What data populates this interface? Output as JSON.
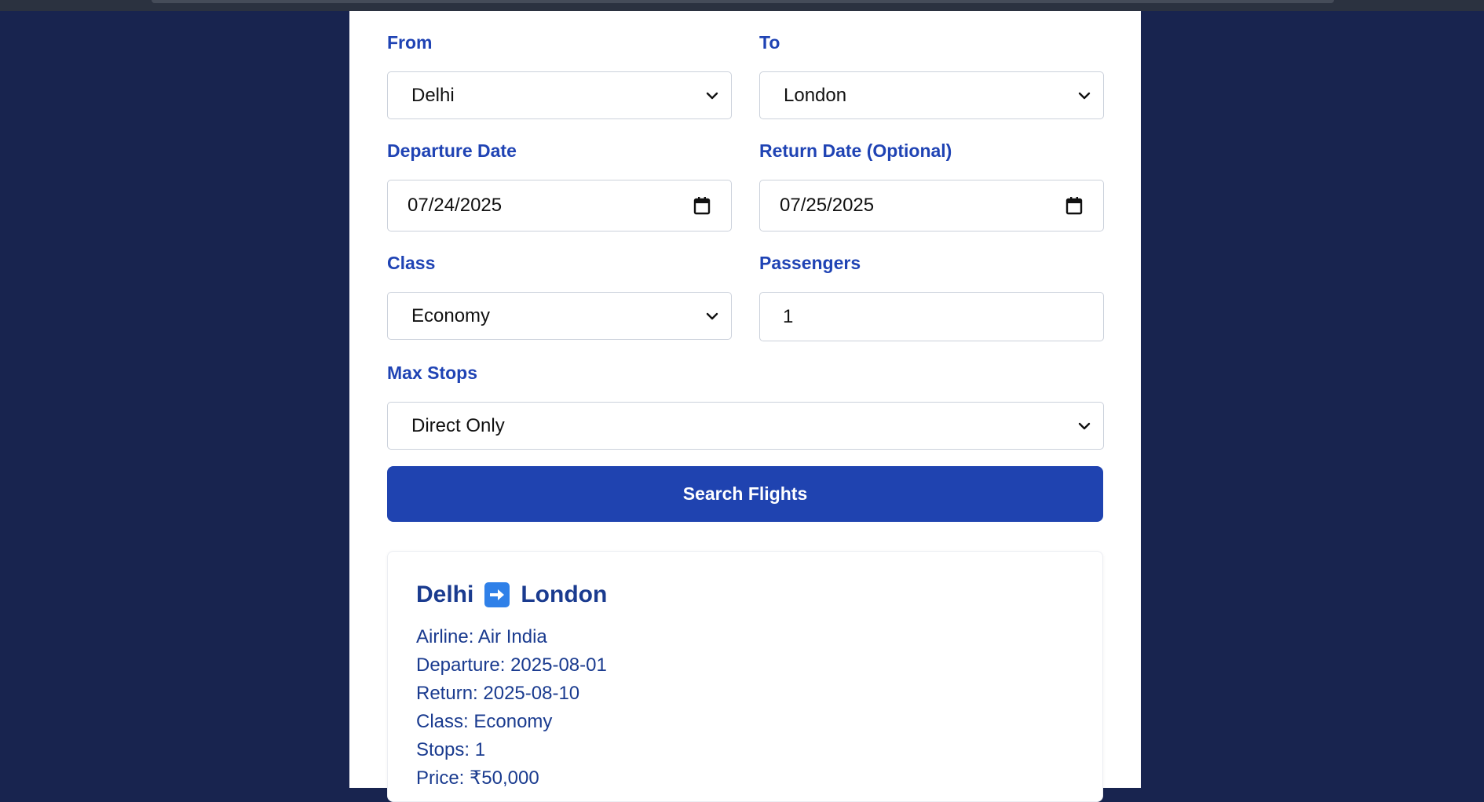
{
  "form": {
    "from": {
      "label": "From",
      "value": "Delhi"
    },
    "to": {
      "label": "To",
      "value": "London"
    },
    "departure": {
      "label": "Departure Date",
      "value": "07/24/2025"
    },
    "return": {
      "label": "Return Date (Optional)",
      "value": "07/25/2025"
    },
    "class": {
      "label": "Class",
      "value": "Economy"
    },
    "passengers": {
      "label": "Passengers",
      "value": "1"
    },
    "max_stops": {
      "label": "Max Stops",
      "value": "Direct Only"
    },
    "search_button": "Search Flights"
  },
  "result": {
    "origin": "Delhi",
    "destination": "London",
    "details": [
      {
        "key": "Airline:",
        "value": "Air India"
      },
      {
        "key": "Departure:",
        "value": "2025-08-01"
      },
      {
        "key": "Return:",
        "value": "2025-08-10"
      },
      {
        "key": "Class:",
        "value": "Economy"
      },
      {
        "key": "Stops:",
        "value": "1"
      },
      {
        "key": "Price:",
        "value": "₹50,000"
      }
    ]
  },
  "icons": {
    "dropdown": "chevron-down-icon",
    "date": "calendar-icon",
    "route_arrow": "right-arrow-icon"
  },
  "colors": {
    "background": "#18244f",
    "accent": "#1f43b0",
    "label": "#1f43b4",
    "result_text": "#1a3b8f"
  }
}
